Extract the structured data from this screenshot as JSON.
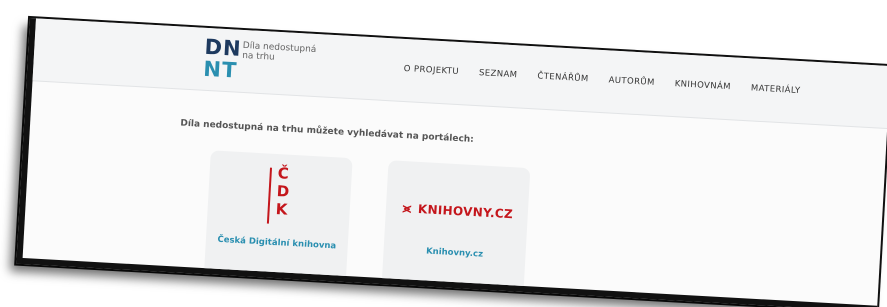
{
  "logo": {
    "mark_line1": "DN",
    "mark_line2": "NT",
    "tagline_line1": "Díla nedostupná",
    "tagline_line2": "na trhu"
  },
  "nav": {
    "items": [
      {
        "label": "O PROJEKTU"
      },
      {
        "label": "SEZNAM"
      },
      {
        "label": "ČTENÁŘŮM"
      },
      {
        "label": "AUTORŮM"
      },
      {
        "label": "KNIHOVNÁM"
      },
      {
        "label": "MATERIÁLY"
      }
    ]
  },
  "intro_text": "Díla nedostupná na trhu můžete vyhledávat na portálech:",
  "cards": [
    {
      "letters": [
        "Č",
        "D",
        "K"
      ],
      "label": "Česká Digitální knihovna"
    },
    {
      "logo_text": "KNIHOVNY.CZ",
      "logo_arrow": "⪤",
      "label": "Knihovny.cz"
    }
  ],
  "colors": {
    "brand_dark": "#1e3a5f",
    "brand_teal": "#2a8fb0",
    "accent_red": "#c4161c"
  }
}
